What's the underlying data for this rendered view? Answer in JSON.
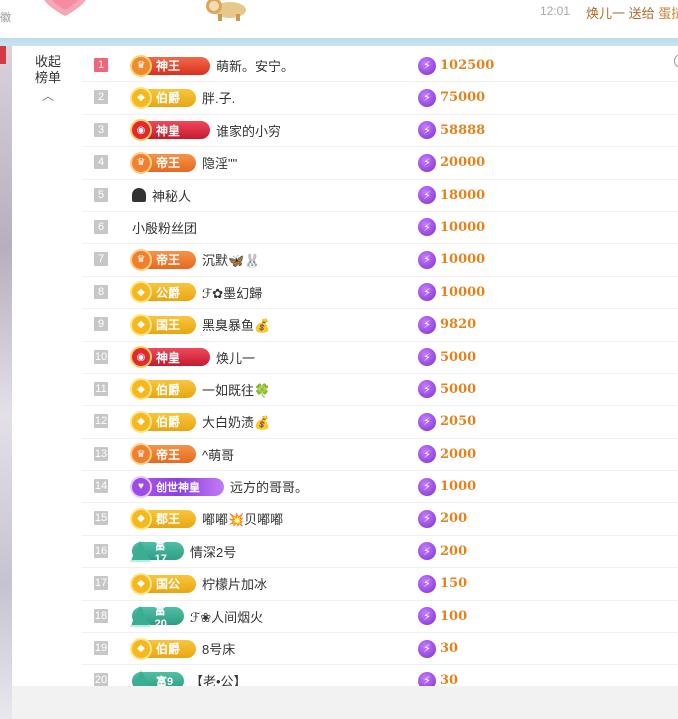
{
  "top": {
    "left_text": "徽",
    "time": "12:01",
    "message_user": "焕儿一",
    "message_action": "送给",
    "message_target": "蛋挞"
  },
  "panel": {
    "collapse_label_line1": "收起",
    "collapse_label_line2": "榜单",
    "collapse_icon": "chevron-up-icon"
  },
  "colors": {
    "rank_first": "#f0647c",
    "rank_default": "#c7c7c7",
    "score": "#e2831e",
    "accent_blue_bar": "#bcdceb"
  },
  "ranking": [
    {
      "rank": "1",
      "badge": "神王",
      "badge_type": "shenwang",
      "name": "萌新。安宁。",
      "score": "102500"
    },
    {
      "rank": "2",
      "badge": "伯爵",
      "badge_type": "gold",
      "name": "胖.子.",
      "score": "75000"
    },
    {
      "rank": "3",
      "badge": "神皇",
      "badge_type": "shenhuang",
      "name": "谁家的小穷",
      "score": "58888"
    },
    {
      "rank": "4",
      "badge": "帝王",
      "badge_type": "diwang",
      "name": "隐淫\"\"",
      "score": "20000"
    },
    {
      "rank": "5",
      "badge": "",
      "badge_type": "mystery",
      "name": "神秘人",
      "score": "18000"
    },
    {
      "rank": "6",
      "badge": "",
      "badge_type": "none",
      "name": "小殷粉丝团",
      "score": "10000"
    },
    {
      "rank": "7",
      "badge": "帝王",
      "badge_type": "diwang",
      "name": "沉默🦋🐰",
      "score": "10000"
    },
    {
      "rank": "8",
      "badge": "公爵",
      "badge_type": "gold",
      "name": "ℱ✿墨幻歸",
      "score": "10000"
    },
    {
      "rank": "9",
      "badge": "国王",
      "badge_type": "gold",
      "name": "黑臭暴鱼💰",
      "score": "9820"
    },
    {
      "rank": "10",
      "badge": "神皇",
      "badge_type": "shenhuang",
      "name": "焕儿一",
      "score": "5000"
    },
    {
      "rank": "11",
      "badge": "伯爵",
      "badge_type": "gold",
      "name": "一如既往🍀",
      "score": "5000"
    },
    {
      "rank": "12",
      "badge": "伯爵",
      "badge_type": "gold",
      "name": "大白奶渍💰",
      "score": "2050"
    },
    {
      "rank": "13",
      "badge": "帝王",
      "badge_type": "diwang",
      "name": "^萌哥",
      "score": "2000"
    },
    {
      "rank": "14",
      "badge": "创世神皇",
      "badge_type": "chuangshi",
      "name": "远方的哥哥。",
      "score": "1000"
    },
    {
      "rank": "15",
      "badge": "郡王",
      "badge_type": "gold",
      "name": "嘟嘟💥贝嘟嘟",
      "score": "200"
    },
    {
      "rank": "16",
      "badge": "富17",
      "badge_type": "fu",
      "name": "情深2号",
      "score": "200"
    },
    {
      "rank": "17",
      "badge": "国公",
      "badge_type": "gold",
      "name": "柠檬片加冰",
      "score": "150"
    },
    {
      "rank": "18",
      "badge": "富20",
      "badge_type": "fu",
      "name": "ℱ❀人间烟火",
      "score": "100"
    },
    {
      "rank": "19",
      "badge": "伯爵",
      "badge_type": "gold",
      "name": "8号床",
      "score": "30"
    },
    {
      "rank": "20",
      "badge": "富9",
      "badge_type": "fu",
      "name": "【老•公】",
      "score": "30"
    }
  ]
}
